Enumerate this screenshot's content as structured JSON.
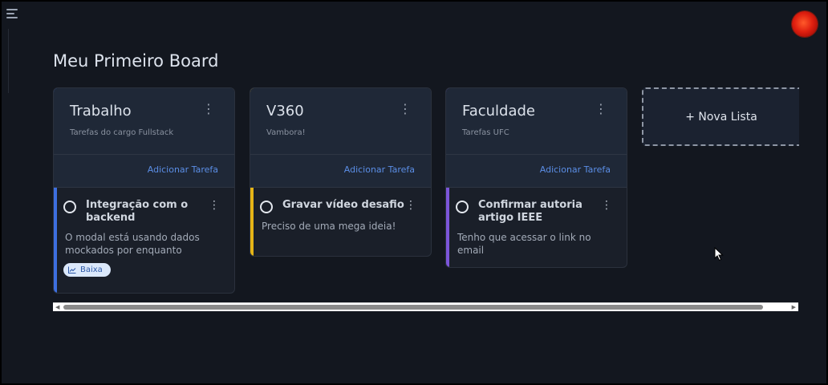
{
  "board": {
    "title": "Meu Primeiro Board"
  },
  "icons": {
    "menu": "hamburger-menu-icon",
    "avatar": "user-avatar",
    "priority": "trend-chart-icon"
  },
  "colors": {
    "background": "#13171f",
    "accent_trabalho": "#3d6fe0",
    "accent_v360": "#e5b416",
    "accent_faculdade": "#7b55d9",
    "link": "#5b8ee6"
  },
  "lists": [
    {
      "title": "Trabalho",
      "subtitle": "Tarefas do cargo Fullstack",
      "add_task_label": "Adicionar Tarefa",
      "task": {
        "title": "Integração com o backend",
        "description": "O modal está usando dados mockados por enquanto",
        "priority": "Baixa"
      }
    },
    {
      "title": "V360",
      "subtitle": "Vambora!",
      "add_task_label": "Adicionar Tarefa",
      "task": {
        "title": "Gravar vídeo desafio",
        "description": "Preciso de uma mega ideia!"
      }
    },
    {
      "title": "Faculdade",
      "subtitle": "Tarefas UFC",
      "add_task_label": "Adicionar Tarefa",
      "task": {
        "title": "Confirmar autoria artigo IEEE",
        "description": "Tenho que acessar o link no email"
      }
    }
  ],
  "new_list": {
    "label": "+ Nova Lista"
  },
  "kebab_glyph": "⋮"
}
